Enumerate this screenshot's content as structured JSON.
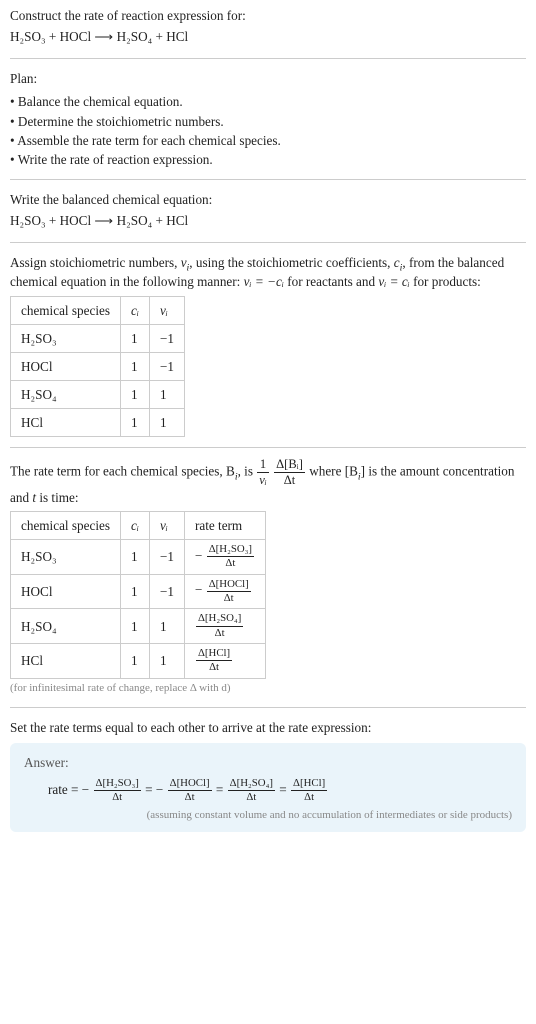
{
  "prompt": "Construct the rate of reaction expression for:",
  "equation_unbalanced": "H₂SO₃ + HOCl ⟶ H₂SO₄ + HCl",
  "plan_heading": "Plan:",
  "plan_items": [
    "Balance the chemical equation.",
    "Determine the stoichiometric numbers.",
    "Assemble the rate term for each chemical species.",
    "Write the rate of reaction expression."
  ],
  "balanced_heading": "Write the balanced chemical equation:",
  "equation_balanced": "H₂SO₃ + HOCl ⟶ H₂SO₄ + HCl",
  "stoich_text": {
    "a": "Assign stoichiometric numbers, ",
    "nu": "ν",
    "b": ", using the stoichiometric coefficients, ",
    "c": "c",
    "d": ", from the balanced chemical equation in the following manner: ",
    "rel_react": "νᵢ = −cᵢ",
    "e": " for reactants and ",
    "rel_prod": "νᵢ = cᵢ",
    "f": " for products:"
  },
  "table1": {
    "headers": [
      "chemical species",
      "cᵢ",
      "νᵢ"
    ],
    "rows": [
      [
        "H₂SO₃",
        "1",
        "−1"
      ],
      [
        "HOCl",
        "1",
        "−1"
      ],
      [
        "H₂SO₄",
        "1",
        "1"
      ],
      [
        "HCl",
        "1",
        "1"
      ]
    ]
  },
  "rateterm_text": {
    "a": "The rate term for each chemical species, B",
    "b": ", is ",
    "c": " where [B",
    "d": "] is the amount concentration and ",
    "e": " is time:"
  },
  "frac1": {
    "num": "1",
    "den": "νᵢ"
  },
  "frac2": {
    "num": "Δ[Bᵢ]",
    "den": "Δt"
  },
  "table2": {
    "headers": [
      "chemical species",
      "cᵢ",
      "νᵢ",
      "rate term"
    ],
    "rows": [
      {
        "sp": "H₂SO₃",
        "c": "1",
        "nu": "−1",
        "sign": "−",
        "num": "Δ[H₂SO₃]",
        "den": "Δt"
      },
      {
        "sp": "HOCl",
        "c": "1",
        "nu": "−1",
        "sign": "−",
        "num": "Δ[HOCl]",
        "den": "Δt"
      },
      {
        "sp": "H₂SO₄",
        "c": "1",
        "nu": "1",
        "sign": "",
        "num": "Δ[H₂SO₄]",
        "den": "Δt"
      },
      {
        "sp": "HCl",
        "c": "1",
        "nu": "1",
        "sign": "",
        "num": "Δ[HCl]",
        "den": "Δt"
      }
    ]
  },
  "infinitesimal_note": "(for infinitesimal rate of change, replace Δ with d)",
  "set_equal_text": "Set the rate terms equal to each other to arrive at the rate expression:",
  "answer": {
    "title": "Answer:",
    "lead": "rate = ",
    "terms": [
      {
        "sign": "−",
        "num": "Δ[H₂SO₃]",
        "den": "Δt"
      },
      {
        "sign": "−",
        "num": "Δ[HOCl]",
        "den": "Δt"
      },
      {
        "sign": "",
        "num": "Δ[H₂SO₄]",
        "den": "Δt"
      },
      {
        "sign": "",
        "num": "Δ[HCl]",
        "den": "Δt"
      }
    ],
    "sep": " = ",
    "assumption": "(assuming constant volume and no accumulation of intermediates or side products)"
  }
}
